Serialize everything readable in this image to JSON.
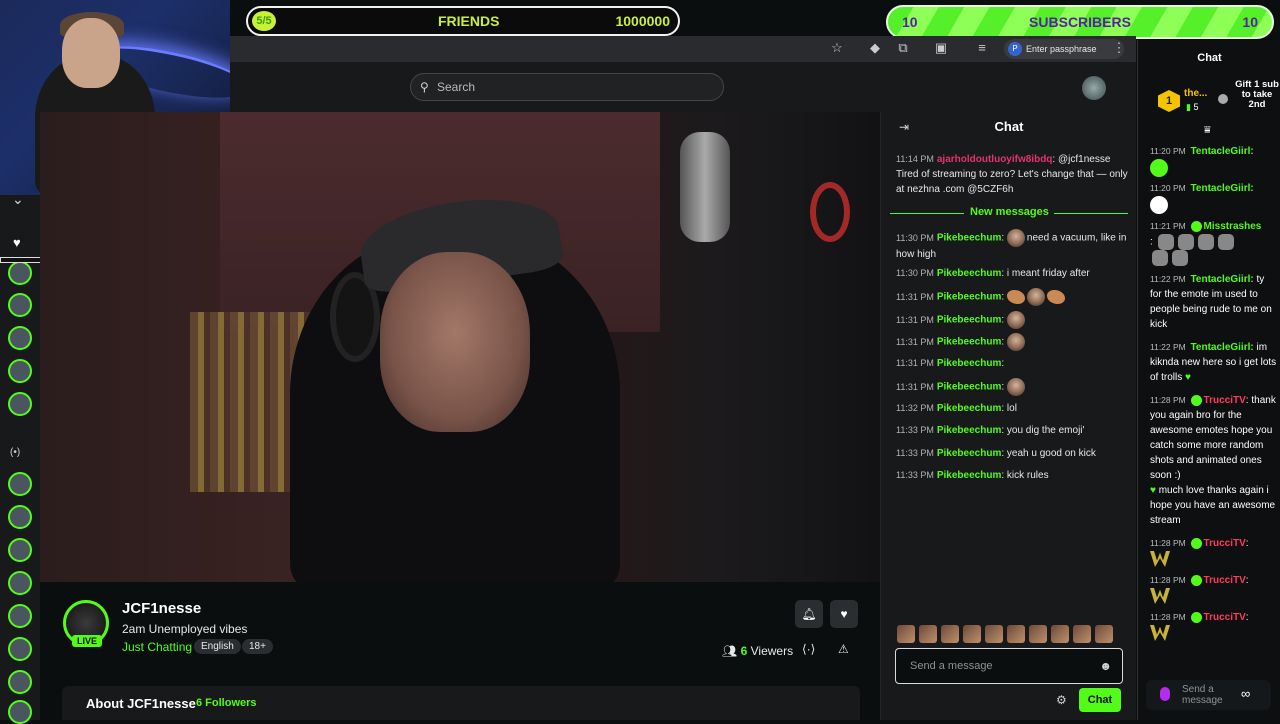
{
  "banners": {
    "friends": {
      "ball": "5/5",
      "label": "FRIENDS",
      "value": "1000000"
    },
    "subscribers": {
      "left": "10",
      "label": "SUBSCRIBERS",
      "right": "10"
    }
  },
  "browser": {
    "passphrase": "Enter passphrase",
    "passphrase_icon": "P"
  },
  "header": {
    "search_placeholder": "Search"
  },
  "stream": {
    "streamer": "JCF1nesse",
    "title": "2am Unemployed vibes",
    "category": "Just Chatting",
    "tags": [
      "English",
      "18+"
    ],
    "live_label": "LIVE",
    "viewers_count": "6",
    "viewers_label": "Viewers",
    "about_title": "About JCF1nesse",
    "followers": "6 Followers"
  },
  "kick_chat": {
    "title": "Chat",
    "pinned": {
      "ts": "11:14 PM",
      "user": "ajarholdoutluoyifw8ibdq",
      "text": "@jcf1nesse Tired of streaming to zero? Let's change that — only at nezhna .com @5CZF6h"
    },
    "new_messages_label": "New messages",
    "messages": [
      {
        "ts": "11:30 PM",
        "user": "Pikebeechum",
        "text": "need a vacuum, like in how high"
      },
      {
        "ts": "11:30 PM",
        "user": "Pikebeechum",
        "text": "i meant friday after"
      },
      {
        "ts": "11:31 PM",
        "user": "Pikebeechum",
        "text": ""
      },
      {
        "ts": "11:31 PM",
        "user": "Pikebeechum",
        "text": ""
      },
      {
        "ts": "11:31 PM",
        "user": "Pikebeechum",
        "text": ""
      },
      {
        "ts": "11:31 PM",
        "user": "Pikebeechum",
        "text": ""
      },
      {
        "ts": "11:31 PM",
        "user": "Pikebeechum",
        "text": ""
      },
      {
        "ts": "11:32 PM",
        "user": "Pikebeechum",
        "text": "lol"
      },
      {
        "ts": "11:33 PM",
        "user": "Pikebeechum",
        "text": "you dig the emoji'"
      },
      {
        "ts": "11:33 PM",
        "user": "Pikebeechum",
        "text": "yeah u good on kick"
      },
      {
        "ts": "11:33 PM",
        "user": "Pikebeechum",
        "text": "kick rules"
      }
    ],
    "input_placeholder": "Send a message",
    "send_label": "Chat"
  },
  "overlay_chat": {
    "title": "Chat",
    "gift": {
      "rank": "1",
      "user": "the...",
      "count": "5",
      "text": "Gift 1 sub to take 2nd"
    },
    "messages": [
      {
        "ts": "11:20 PM",
        "user": "TentacleGiirl:",
        "text": "",
        "color": "#53fc18"
      },
      {
        "ts": "11:20 PM",
        "user": "TentacleGiirl:",
        "text": "",
        "color": "#53fc18"
      },
      {
        "ts": "11:21 PM",
        "user": "Misstrashes",
        "text": "",
        "color": "#53fc18"
      },
      {
        "ts": "11:22 PM",
        "user": "TentacleGiirl:",
        "text": "ty for the emote im used to people being rude to me on kick",
        "color": "#53fc18"
      },
      {
        "ts": "11:22 PM",
        "user": "TentacleGiirl:",
        "text": "im kiknda new here so i get lots of trolls",
        "color": "#53fc18"
      },
      {
        "ts": "11:28 PM",
        "user": "TrucciTV",
        "text": ": thank you again bro for the awesome emotes hope you catch some more random shots and animated ones soon :) ",
        "color": "#ff3b5c"
      },
      {
        "ts": "11:28 PM",
        "user": "TrucciTV",
        "text": ":",
        "color": "#ff3b5c"
      },
      {
        "ts": "11:28 PM",
        "user": "TrucciTV",
        "text": ":",
        "color": "#ff3b5c"
      },
      {
        "ts": "11:28 PM",
        "user": "TrucciTV",
        "text": ":",
        "color": "#ff3b5c"
      }
    ],
    "tail_text": "much love thanks again i hope you have an awesome stream",
    "input_placeholder": "Send a message"
  }
}
